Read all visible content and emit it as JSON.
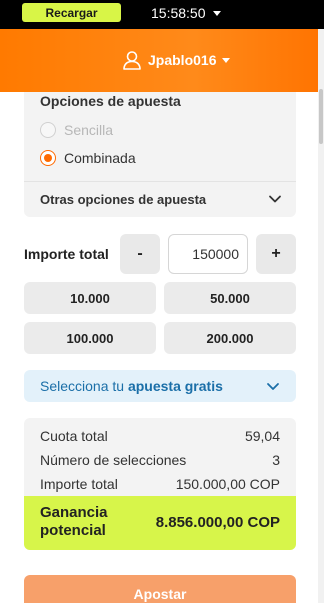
{
  "status_bar": {
    "recharge_label": "Recargar",
    "time": "15:58:50"
  },
  "header": {
    "username": "Jpablo016"
  },
  "bet_options": {
    "title": "Opciones de apuesta",
    "options": [
      {
        "label": "Sencilla",
        "selected": false,
        "disabled": true
      },
      {
        "label": "Combinada",
        "selected": true,
        "disabled": false
      }
    ],
    "other_options_label": "Otras opciones de apuesta"
  },
  "stake": {
    "label": "Importe total",
    "minus_label": "-",
    "plus_label": "+",
    "value": "150000"
  },
  "quick_amounts": [
    "10.000",
    "50.000",
    "100.000",
    "200.000"
  ],
  "free_bet": {
    "prefix": "Selecciona tu ",
    "highlight": "apuesta gratis"
  },
  "summary": {
    "rows": [
      {
        "label": "Cuota total",
        "value": "59,04"
      },
      {
        "label": "Número de selecciones",
        "value": "3"
      },
      {
        "label": "Importe total",
        "value": "150.000,00 COP"
      }
    ],
    "winnings_label_line1": "Ganancia",
    "winnings_label_line2": "potencial",
    "winnings_value": "8.856.000,00 COP"
  },
  "submit": {
    "label": "Apostar"
  },
  "colors": {
    "brand_orange": "#ff7a00",
    "accent_lime": "#d7f54a",
    "link_blue": "#1b6fa8"
  }
}
